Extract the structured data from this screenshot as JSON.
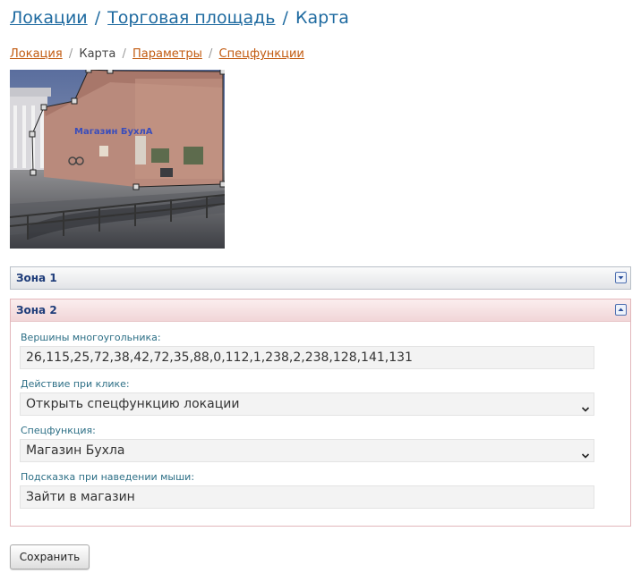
{
  "title": {
    "crumb1": "Локации",
    "crumb2": "Торговая площадь",
    "current": "Карта",
    "separator": "/"
  },
  "tabs": {
    "location": "Локация",
    "map": "Карта",
    "params": "Параметры",
    "specfuncs": "Спецфункции",
    "separator": "/"
  },
  "map_image": {
    "sign_text": "Магазин БухлА"
  },
  "zones": [
    {
      "label": "Зона 1",
      "state": "collapsed",
      "toggle_icon": "chevron-down-icon"
    },
    {
      "label": "Зона 2",
      "state": "expanded",
      "toggle_icon": "chevron-up-icon"
    }
  ],
  "form": {
    "vertices_label": "Вершины многоугольника:",
    "vertices_value": "26,115,25,72,38,42,72,35,88,0,112,1,238,2,238,128,141,131",
    "action_label": "Действие при клике:",
    "action_value": "Открыть спецфункцию локации",
    "specfunc_label": "Спецфункция:",
    "specfunc_value": "Магазин Бухла",
    "hint_label": "Подсказка при наведении мыши:",
    "hint_value": "Зайти в магазин"
  },
  "buttons": {
    "save": "Сохранить"
  },
  "colors": {
    "title_link": "#1e6aa0",
    "tab_link": "#c25b10",
    "field_label": "#2d6f86",
    "zone_active_border": "#e2b7bb",
    "zone_header_text": "#1f3d7a"
  }
}
